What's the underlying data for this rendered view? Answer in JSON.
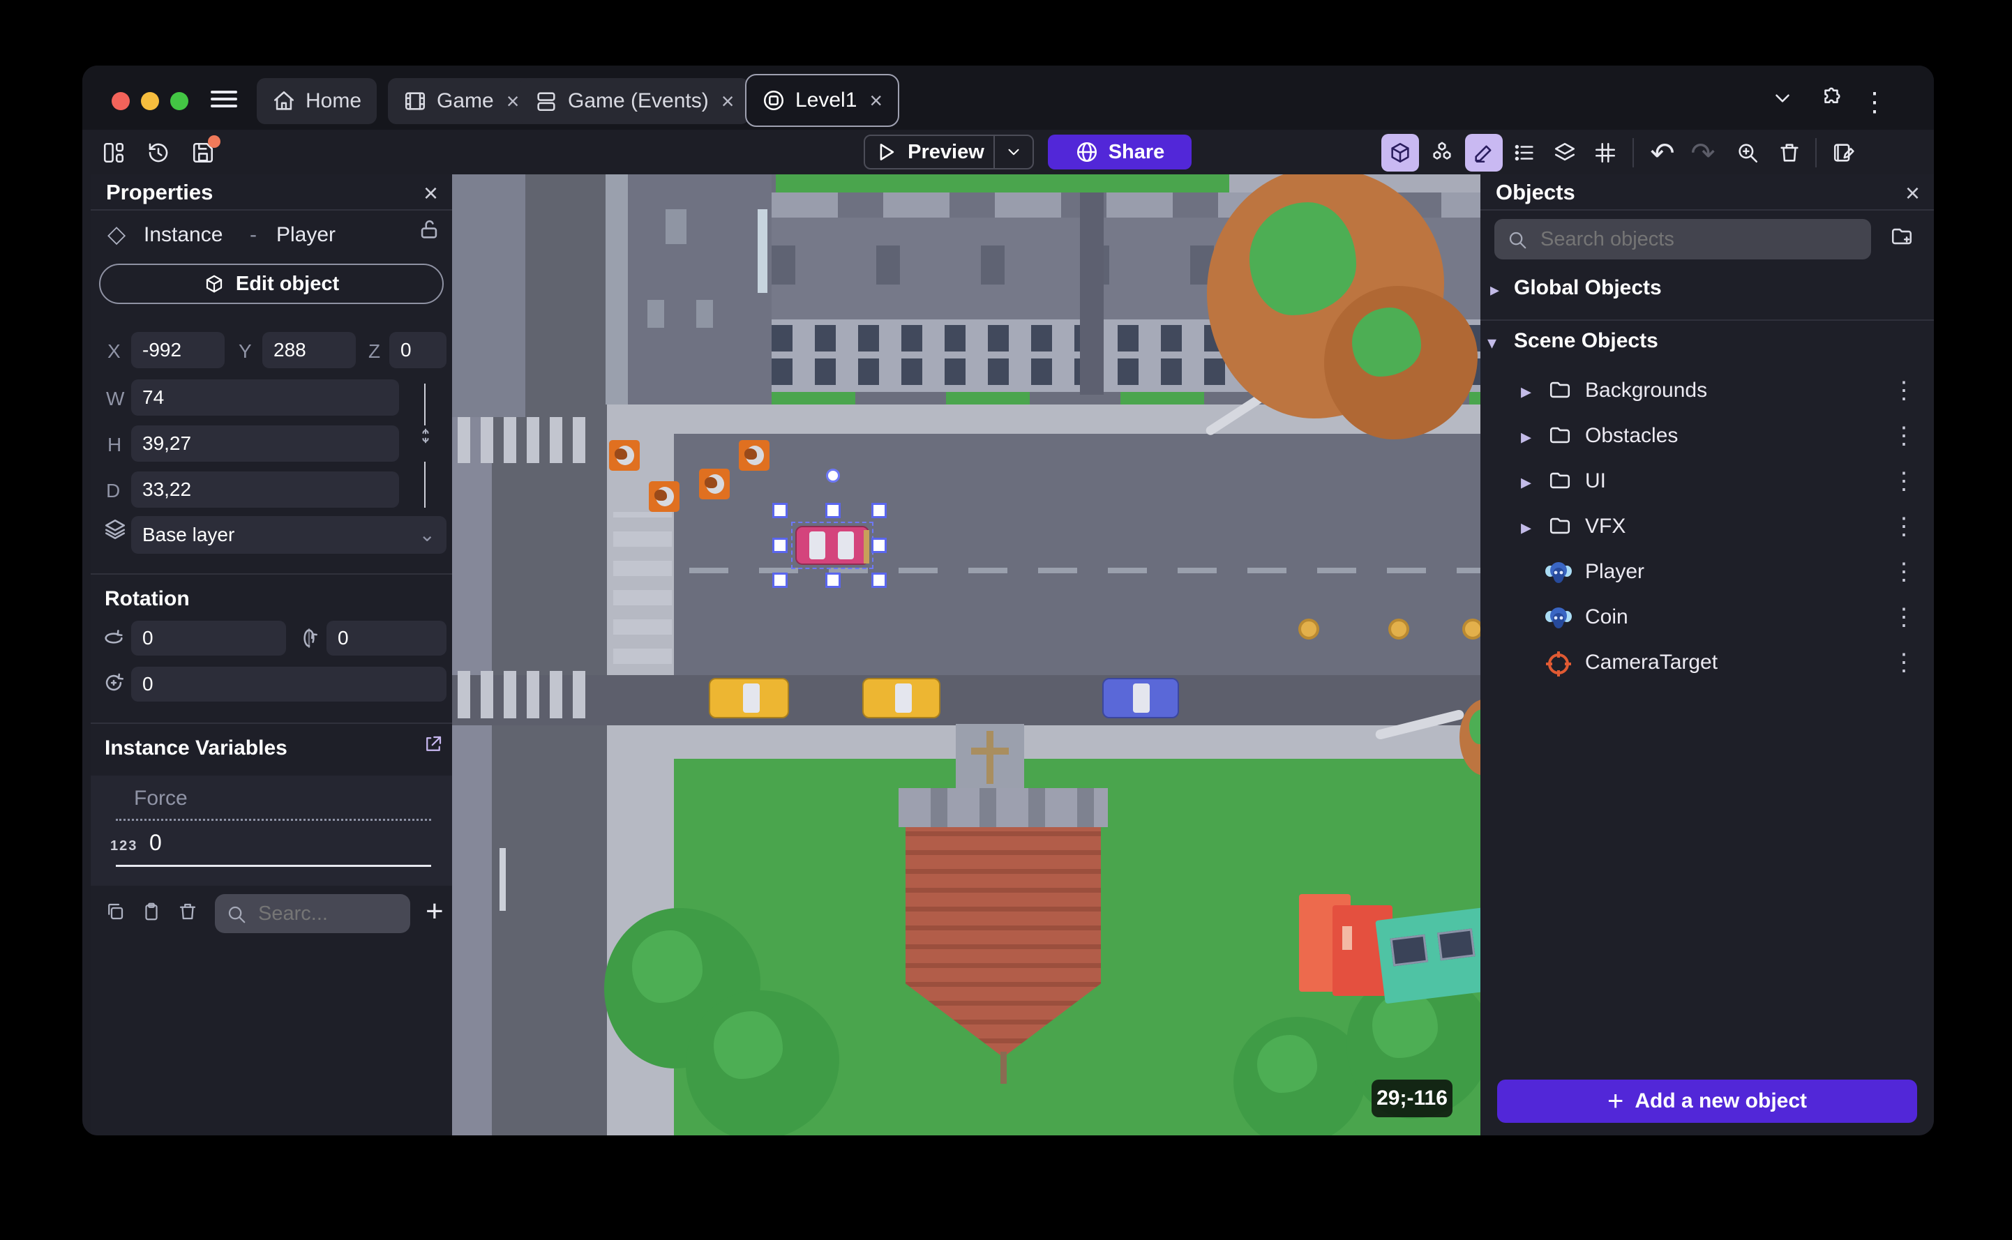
{
  "tabs": {
    "home": "Home",
    "game": "Game",
    "events": "Game (Events)",
    "level": "Level1"
  },
  "toolbar": {
    "preview": "Preview",
    "share": "Share"
  },
  "properties": {
    "title": "Properties",
    "instance_type": "Instance",
    "sep": "-",
    "instance_name": "Player",
    "edit_object": "Edit object",
    "x_label": "X",
    "x": "-992",
    "y_label": "Y",
    "y": "288",
    "z_label": "Z",
    "z": "0",
    "w_label": "W",
    "w": "74",
    "h_label": "H",
    "h": "39,27",
    "d_label": "D",
    "d": "33,22",
    "layer": "Base layer",
    "rotation_title": "Rotation",
    "rot_x": "0",
    "rot_y": "0",
    "rot_z": "0",
    "variables_title": "Instance Variables",
    "var_name": "Force",
    "var_type": "123",
    "var_value": "0",
    "search_placeholder": "Searc..."
  },
  "objects": {
    "title": "Objects",
    "search_placeholder": "Search objects",
    "global_header": "Global Objects",
    "scene_header": "Scene Objects",
    "folders": [
      "Backgrounds",
      "Obstacles",
      "UI",
      "VFX"
    ],
    "items": [
      "Player",
      "Coin",
      "CameraTarget"
    ],
    "add_button": "Add a new object"
  },
  "scene": {
    "coords_badge": "29;-116"
  },
  "colors": {
    "accent": "#5227d8",
    "active_chip": "#c9b9f2",
    "grass": "#4aa54d",
    "road": "#6b6e7d",
    "selection": "#5a66ee",
    "player_car": "#d4447c"
  }
}
